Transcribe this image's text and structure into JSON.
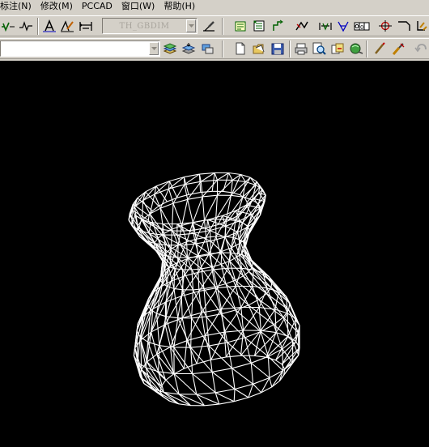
{
  "menubar": {
    "items": [
      {
        "label": "标注(N)"
      },
      {
        "label": "修改(M)"
      },
      {
        "label": "PCCAD"
      },
      {
        "label": "窗口(W)"
      },
      {
        "label": "帮助(H)"
      }
    ]
  },
  "toolbar1": {
    "style_combo_value": "TH_GBDIM",
    "icons": [
      "dimension-check-icon",
      "break-line-icon",
      "text-style-icon",
      "edit-dimension-icon",
      "align-dimension-icon",
      "leader-icon",
      "hole-table-icon",
      "datum-icon",
      "welding-icon",
      "roughness-icon",
      "surface-finish-icon",
      "tolerance-frame-icon",
      "center-mark-icon",
      "section-line-icon",
      "fit-tolerance-icon"
    ]
  },
  "toolbar2": {
    "layer_combo_value": "",
    "icons": [
      "layer-manager-icon",
      "layer-state-icon",
      "layer-previous-icon",
      "new-file-icon",
      "open-file-icon",
      "save-icon",
      "print-icon",
      "plot-preview-icon",
      "publish-icon",
      "render-icon",
      "match-properties-icon",
      "brush-icon",
      "undo-icon"
    ]
  },
  "viewport": {
    "background": "#000000",
    "wire_color": "#ffffff",
    "object_icon": "vase-wireframe-model"
  }
}
